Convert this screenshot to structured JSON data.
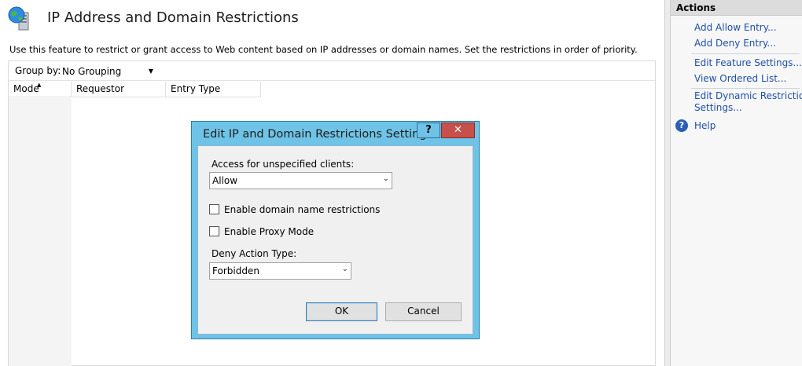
{
  "page": {
    "title": "IP Address and Domain Restrictions",
    "description": "Use this feature to restrict or grant access to Web content based on IP addresses or domain names. Set the restrictions in order of priority.",
    "icon": "globe-server-icon"
  },
  "list": {
    "group_by_label": "Group by:",
    "group_by_value": "No Grouping",
    "columns": [
      "Mode",
      "Requestor",
      "Entry Type"
    ]
  },
  "actions": {
    "header": "Actions",
    "links": {
      "add_allow": "Add Allow Entry...",
      "add_deny": "Add Deny Entry...",
      "edit_feature": "Edit Feature Settings...",
      "view_ordered": "View Ordered List...",
      "edit_dynamic_1": "Edit Dynamic Restriction",
      "edit_dynamic_2": "Settings...",
      "help": "Help"
    }
  },
  "dialog": {
    "title": "Edit IP and Domain Restrictions Settings",
    "help_glyph": "?",
    "close_glyph": "✕",
    "access_label": "Access for unspecified clients:",
    "access_value": "Allow",
    "domain_restrictions_label": "Enable domain name restrictions",
    "domain_restrictions_checked": false,
    "proxy_mode_label": "Enable Proxy Mode",
    "proxy_mode_checked": false,
    "deny_action_label": "Deny Action Type:",
    "deny_action_value": "Forbidden",
    "ok_label": "OK",
    "cancel_label": "Cancel"
  },
  "colors": {
    "dialog_frame": "#6fc3e6",
    "close_button": "#c7504a",
    "link": "#1f4fa6"
  }
}
